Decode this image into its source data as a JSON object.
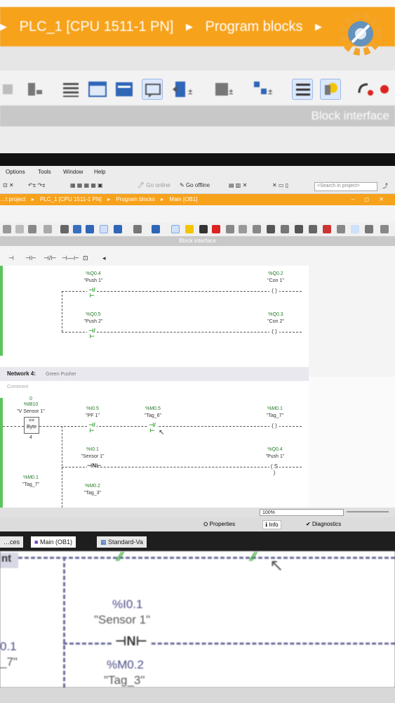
{
  "top_zoom": {
    "breadcrumb": [
      "PLC_1 [CPU 1511-1 PN]",
      "▸",
      "Program blocks",
      "▸"
    ],
    "block_interface": "Block interface"
  },
  "menu": [
    "Options",
    "Tools",
    "Window",
    "Help"
  ],
  "toolbar": {
    "go_online": "Go online",
    "go_offline": "Go offline",
    "search_placeholder": "<Search in project>"
  },
  "breadcrumb": [
    "…t project",
    "▸",
    "PLC_1 [CPU 1511-1 PN]",
    "▸",
    "Program blocks",
    "▸",
    "Main [OB1]"
  ],
  "window_buttons": "– ◻ ✕",
  "block_interface": "Block interface",
  "ladder_tools": [
    "⊣",
    "⊣⊢",
    "⊣/⊢",
    "⊣—⊢",
    "⊡",
    "◂"
  ],
  "network3": {
    "rows": [
      {
        "contact_addr": "%Q0.4",
        "contact_tag": "\"Push 1\"",
        "coil_addr": "%Q0.2",
        "coil_tag": "\"Con 1\""
      },
      {
        "contact_addr": "%Q0.5",
        "contact_tag": "\"Push 2\"",
        "coil_addr": "%Q0.3",
        "coil_tag": "\"Con 2\""
      }
    ]
  },
  "network4": {
    "title": "Network 4:",
    "name": "Green Pusher",
    "comment": "Comment",
    "cmp_value": "0",
    "cmp_addr": "%IB10",
    "cmp_tag": "\"V Sensor 1\"",
    "cmp_op": "==",
    "cmp_type": "Byte",
    "cmp_const": "4",
    "row1": {
      "c1_addr": "%I0.5",
      "c1_tag": "\"PF 1\"",
      "c2_addr": "%M0.5",
      "c2_tag": "\"Tag_6\"",
      "coil_addr": "%M0.1",
      "coil_tag": "\"Tag_7\""
    },
    "row2": {
      "c_addr": "%I0.1",
      "c_tag": "\"Sensor 1\"",
      "coil_addr": "%Q0.4",
      "coil_tag": "\"Push 1\"",
      "n_label": "N"
    },
    "row3": {
      "left_addr": "%M0.1",
      "left_tag": "\"Tag_7\"",
      "mid_addr": "%M0.2",
      "mid_tag": "\"Tag_3\""
    }
  },
  "zoom_level": "100%",
  "inspector_tabs": [
    "Properties",
    "Info",
    "Diagnostics"
  ],
  "editor_tabs": [
    "…ces",
    "Main (OB1)",
    "Standard-Va..."
  ],
  "bottom_zoom": {
    "tab_left": "…ces",
    "tab_main": "Main (OB1)",
    "tab_std": "Standard-Va",
    "left_label": "nt",
    "sensor_addr": "%I0.1",
    "sensor_tag": "\"Sensor 1\"",
    "n_label": "N",
    "left_addr2": "0.1",
    "left_tag2": "_7\"",
    "m_addr": "%M0.2",
    "m_tag": "\"Tag_3\""
  },
  "colors": {
    "tia_orange": "#f7a21b",
    "contact_green": "#2a9a2a",
    "rail_green": "#5cc35c"
  }
}
